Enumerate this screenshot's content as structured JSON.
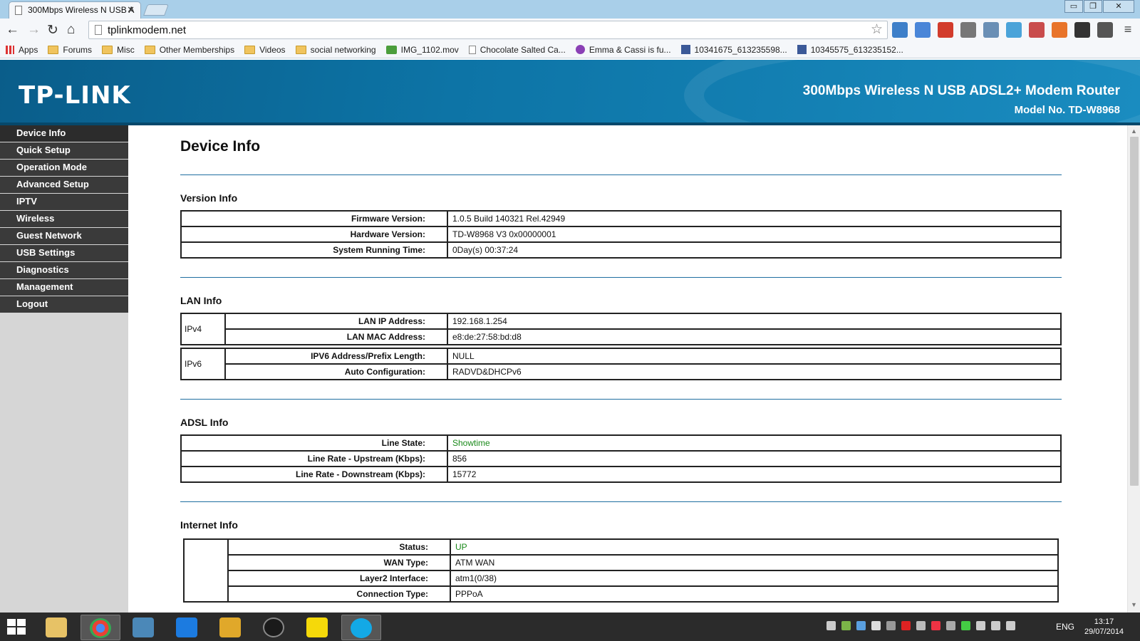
{
  "browser": {
    "tab_title": "300Mbps Wireless N USB A",
    "url": "tplinkmodem.net",
    "window_buttons": {
      "minimize": "▭",
      "restore": "❐",
      "close": "✕"
    },
    "bookmarks": [
      {
        "label": "Apps",
        "icon": "apps-icon"
      },
      {
        "label": "Forums",
        "icon": "folder-icon"
      },
      {
        "label": "Misc",
        "icon": "folder-icon"
      },
      {
        "label": "Other Memberships",
        "icon": "folder-icon"
      },
      {
        "label": "Videos",
        "icon": "folder-icon"
      },
      {
        "label": "social networking",
        "icon": "folder-icon"
      },
      {
        "label": "IMG_1102.mov",
        "icon": "download-icon"
      },
      {
        "label": "Chocolate Salted Ca...",
        "icon": "page-icon"
      },
      {
        "label": "Emma & Cassi is fu...",
        "icon": "g-icon"
      },
      {
        "label": "10341675_613235598...",
        "icon": "facebook-icon"
      },
      {
        "label": "10345575_613235152...",
        "icon": "facebook-icon"
      }
    ]
  },
  "router": {
    "logo": "TP-LINK",
    "product": "300Mbps Wireless N USB ADSL2+ Modem Router",
    "model": "Model No. TD-W8968",
    "colors": {
      "header": "#0d74a6",
      "menu": "#3a3a3a",
      "status_green": "#1b8a1b"
    }
  },
  "menu": [
    "Device Info",
    "Quick Setup",
    "Operation Mode",
    "Advanced Setup",
    "IPTV",
    "Wireless",
    "Guest Network",
    "USB Settings",
    "Diagnostics",
    "Management",
    "Logout"
  ],
  "page": {
    "title": "Device Info",
    "version": {
      "title": "Version Info",
      "rows": [
        {
          "label": "Firmware Version:",
          "value": "1.0.5 Build 140321 Rel.42949"
        },
        {
          "label": "Hardware Version:",
          "value": "TD-W8968 V3 0x00000001"
        },
        {
          "label": "System Running Time:",
          "value": "0Day(s) 00:37:24"
        }
      ]
    },
    "lan": {
      "title": "LAN Info",
      "ipv4": {
        "group": "IPv4",
        "rows": [
          {
            "label": "LAN IP Address:",
            "value": "192.168.1.254"
          },
          {
            "label": "LAN MAC Address:",
            "value": "e8:de:27:58:bd:d8"
          }
        ]
      },
      "ipv6": {
        "group": "IPv6",
        "rows": [
          {
            "label": "IPV6 Address/Prefix Length:",
            "value": "NULL"
          },
          {
            "label": "Auto Configuration:",
            "value": "RADVD&DHCPv6"
          }
        ]
      }
    },
    "adsl": {
      "title": "ADSL Info",
      "rows": [
        {
          "label": "Line State:",
          "value": "Showtime"
        },
        {
          "label": "Line Rate - Upstream (Kbps):",
          "value": "856"
        },
        {
          "label": "Line Rate - Downstream (Kbps):",
          "value": "15772"
        }
      ]
    },
    "internet": {
      "title": "Internet Info",
      "rows": [
        {
          "label": "Status:",
          "value": "UP"
        },
        {
          "label": "WAN Type:",
          "value": "ATM WAN"
        },
        {
          "label": "Layer2 Interface:",
          "value": "atm1(0/38)"
        },
        {
          "label": "Connection Type:",
          "value": "PPPoA"
        }
      ]
    }
  },
  "taskbar": {
    "apps": [
      "file-explorer",
      "chrome",
      "media-player",
      "app-store-a",
      "game",
      "obs",
      "sticky-notes",
      "skype"
    ],
    "language": "ENG",
    "time": "13:17",
    "date": "29/07/2014"
  }
}
